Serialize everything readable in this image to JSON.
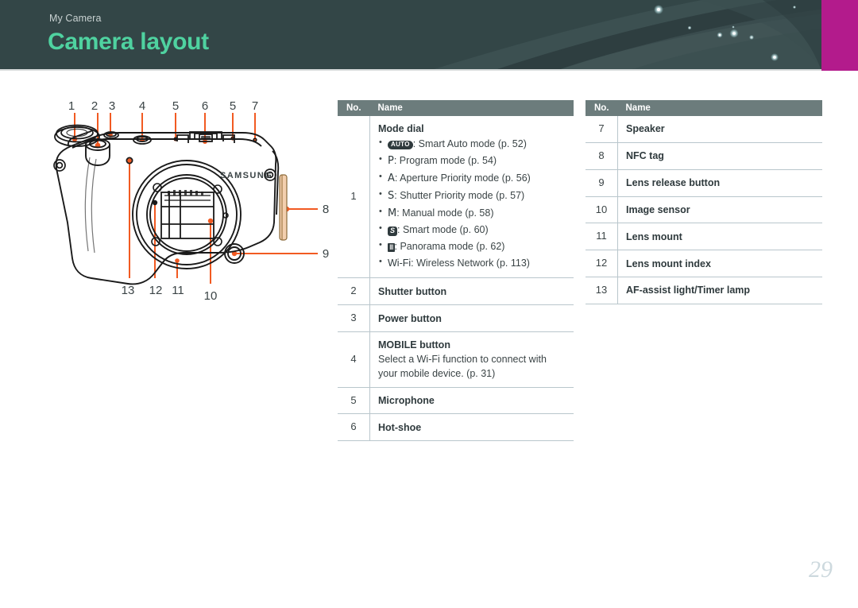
{
  "header": {
    "breadcrumb": "My Camera",
    "title": "Camera layout",
    "bg_color": "#334647",
    "title_color": "#4fd2a0",
    "accent_color": "#b31b8c"
  },
  "diagram": {
    "name": "camera-front-view-illustration",
    "brand_label": "SAMSUNG",
    "callout_color": "#f15a22",
    "callouts_top": [
      "1",
      "2",
      "3",
      "4",
      "5",
      "6",
      "5",
      "7"
    ],
    "callouts_right": [
      "8",
      "9"
    ],
    "callouts_bottom": [
      "13",
      "12",
      "11",
      "10"
    ]
  },
  "table_left": {
    "headers": {
      "no": "No.",
      "name": "Name"
    },
    "rows": [
      {
        "no": "1",
        "title": "Mode dial",
        "bullets": [
          {
            "icon": "auto-badge",
            "icon_text": "AUTO",
            "text": ": Smart Auto mode (p. 52)"
          },
          {
            "icon": "letter-p",
            "icon_text": "P",
            "text": ": Program mode (p. 54)"
          },
          {
            "icon": "letter-a",
            "icon_text": "A",
            "text": ": Aperture Priority mode (p. 56)"
          },
          {
            "icon": "letter-s",
            "icon_text": "S",
            "text": ": Shutter Priority mode (p. 57)"
          },
          {
            "icon": "letter-m",
            "icon_text": "M",
            "text": ": Manual mode (p. 58)"
          },
          {
            "icon": "smart-badge",
            "icon_text": "S",
            "text": ": Smart mode (p. 60)"
          },
          {
            "icon": "panorama-badge",
            "icon_text": "III",
            "text": ": Panorama mode (p. 62)"
          },
          {
            "icon": "wifi-text",
            "icon_text": "Wi-Fi",
            "text": ": Wireless Network (p. 113)"
          }
        ]
      },
      {
        "no": "2",
        "title": "Shutter button",
        "desc": ""
      },
      {
        "no": "3",
        "title": "Power button",
        "desc": ""
      },
      {
        "no": "4",
        "title": "MOBILE button",
        "desc": "Select a Wi-Fi function to connect with your mobile device. (p. 31)"
      },
      {
        "no": "5",
        "title": "Microphone",
        "desc": ""
      },
      {
        "no": "6",
        "title": "Hot-shoe",
        "desc": ""
      }
    ]
  },
  "table_right": {
    "headers": {
      "no": "No.",
      "name": "Name"
    },
    "rows": [
      {
        "no": "7",
        "title": "Speaker"
      },
      {
        "no": "8",
        "title": "NFC tag"
      },
      {
        "no": "9",
        "title": "Lens release button"
      },
      {
        "no": "10",
        "title": "Image sensor"
      },
      {
        "no": "11",
        "title": "Lens mount"
      },
      {
        "no": "12",
        "title": "Lens mount index"
      },
      {
        "no": "13",
        "title": "AF-assist light/Timer lamp"
      }
    ]
  },
  "footer": {
    "page_number": "29"
  }
}
